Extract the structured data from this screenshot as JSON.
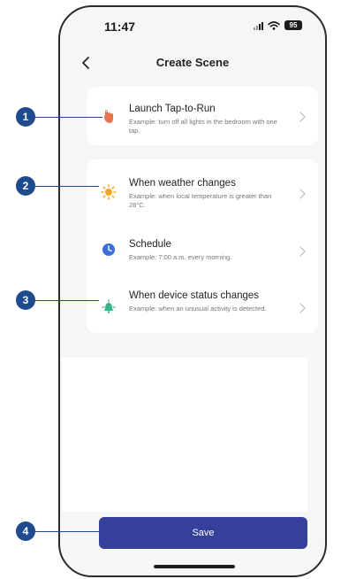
{
  "status_bar": {
    "time": "11:47",
    "battery": "95",
    "icons": [
      "signal-icon",
      "wifi-icon",
      "battery-icon"
    ]
  },
  "header": {
    "title": "Create Scene",
    "back_icon": "chevron-left-icon"
  },
  "options": [
    {
      "title": "Launch Tap-to-Run",
      "description": "Example: turn off all lights in the bedroom with one tap.",
      "icon": "tap-hand-icon",
      "icon_color": "#e8734f"
    },
    {
      "title": "When weather changes",
      "description": "Example: when local temperature is greater than 28°C.",
      "icon": "sun-icon",
      "icon_color": "#f5a623"
    },
    {
      "title": "Schedule",
      "description": "Example: 7:00 a.m. every morning.",
      "icon": "clock-icon",
      "icon_color": "#3b6fd4"
    },
    {
      "title": "When device status changes",
      "description": "Example: when an unusual activity is detected.",
      "icon": "device-icon",
      "icon_color": "#35b58a"
    }
  ],
  "save_label": "Save",
  "callouts": [
    "1",
    "2",
    "3",
    "4"
  ],
  "colors": {
    "accent": "#34409a",
    "callout": "#1f4a8e",
    "background": "#f6f6f6"
  }
}
